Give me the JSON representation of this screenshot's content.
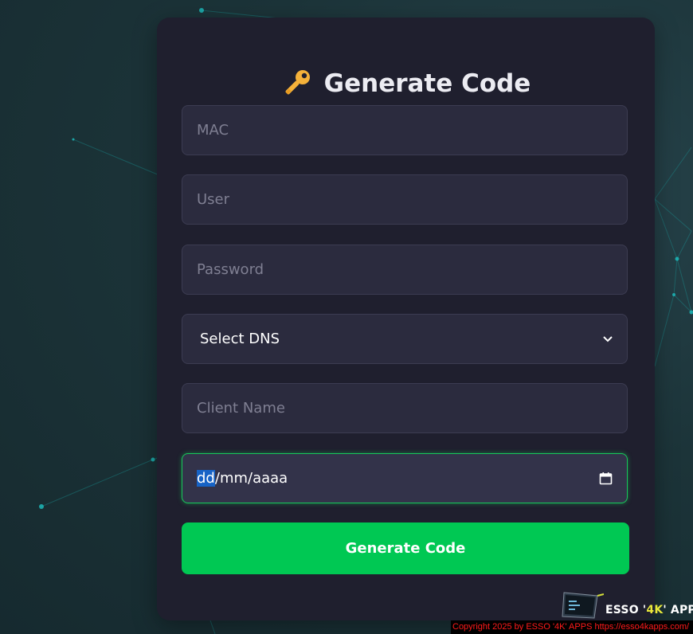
{
  "form": {
    "title": "Generate Code",
    "title_icon": "key-icon",
    "mac": {
      "placeholder": "MAC",
      "value": ""
    },
    "user": {
      "placeholder": "User",
      "value": ""
    },
    "password": {
      "placeholder": "Password",
      "value": ""
    },
    "dns": {
      "selected": "Select DNS"
    },
    "client_name": {
      "placeholder": "Client Name",
      "value": ""
    },
    "date": {
      "day": "dd",
      "month": "mm",
      "year": "aaaa",
      "separator": "/"
    },
    "submit_label": "Generate Code"
  },
  "brand": {
    "name_prefix": "ESSO '",
    "name_highlight": "4K",
    "name_suffix": "' APPS"
  },
  "footer": {
    "text": "Copyright 2025  by ESSO '4K' APPS https://esso4kapps.com/"
  },
  "colors": {
    "accent": "#00c853",
    "card": "#1f1f2e",
    "input": "#2b2b3e",
    "footer_text": "#ff1a1a"
  }
}
